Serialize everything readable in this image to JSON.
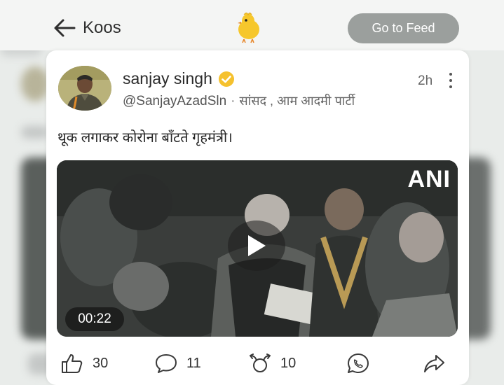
{
  "header": {
    "back_label": "Koos",
    "go_feed_label": "Go to Feed"
  },
  "post": {
    "author_name": "sanjay singh",
    "handle": "@SanjayAzadSln",
    "separator": "·",
    "designation": "सांसद , आम आदमी पार्टी",
    "time": "2h",
    "text": "थूक लगाकर कोरोना बाँटते गृहमंत्री।"
  },
  "video": {
    "watermark": "ANI",
    "duration": "00:22"
  },
  "actions": {
    "likes": "30",
    "comments": "11",
    "rekoos": "10"
  },
  "colors": {
    "go_feed_bg": "#9b9f9d",
    "verified": "#f5c12e",
    "logo_yellow": "#f6c72c"
  },
  "icons": [
    "back-arrow-icon",
    "koo-bird-logo",
    "verified-badge-icon",
    "more-options-icon",
    "play-icon",
    "like-icon",
    "comment-icon",
    "rekoo-icon",
    "whatsapp-icon",
    "share-icon"
  ]
}
